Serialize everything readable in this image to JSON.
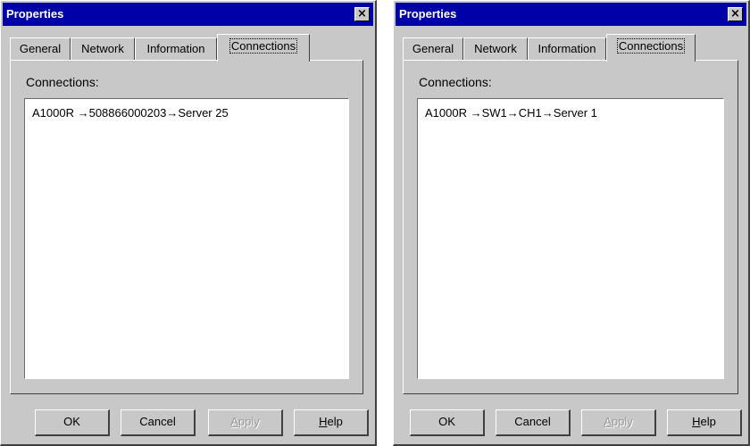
{
  "dialogs": [
    {
      "title": "Properties",
      "close_symbol": "×",
      "tabs": [
        {
          "label": "General",
          "active": false
        },
        {
          "label": "Network",
          "active": false
        },
        {
          "label": "Information",
          "active": false
        },
        {
          "label": "Connections",
          "active": true
        }
      ],
      "connections_label": "Connections:",
      "connection_path": "A1000R →508866000203→Server 25",
      "buttons": {
        "ok": {
          "label": "OK",
          "enabled": true
        },
        "cancel": {
          "label": "Cancel",
          "enabled": true
        },
        "apply": {
          "label": "Apply",
          "mnemonic": "A",
          "rest": "pply",
          "enabled": false
        },
        "help": {
          "label": "Help",
          "mnemonic": "H",
          "rest": "elp",
          "enabled": true
        }
      }
    },
    {
      "title": "Properties",
      "close_symbol": "×",
      "tabs": [
        {
          "label": "General",
          "active": false
        },
        {
          "label": "Network",
          "active": false
        },
        {
          "label": "Information",
          "active": false
        },
        {
          "label": "Connections",
          "active": true
        }
      ],
      "connections_label": "Connections:",
      "connection_path": "A1000R →SW1→CH1→Server 1",
      "buttons": {
        "ok": {
          "label": "OK",
          "enabled": true
        },
        "cancel": {
          "label": "Cancel",
          "enabled": true
        },
        "apply": {
          "label": "Apply",
          "mnemonic": "A",
          "rest": "pply",
          "enabled": false
        },
        "help": {
          "label": "Help",
          "mnemonic": "H",
          "rest": "elp",
          "enabled": true
        }
      }
    }
  ]
}
